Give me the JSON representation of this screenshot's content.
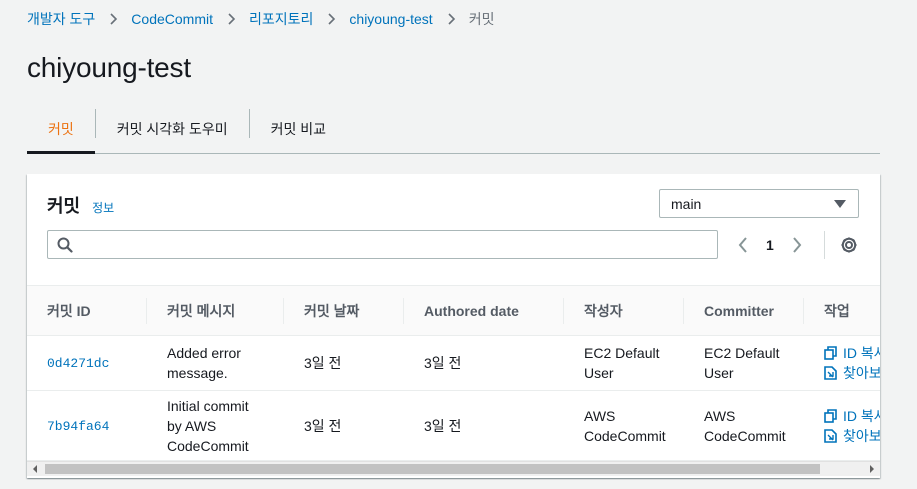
{
  "breadcrumb": {
    "items": [
      "개발자 도구",
      "CodeCommit",
      "리포지토리",
      "chiyoung-test"
    ],
    "current": "커밋"
  },
  "page_title": "chiyoung-test",
  "tabs": [
    {
      "label": "커밋",
      "active": true
    },
    {
      "label": "커밋 시각화 도우미",
      "active": false
    },
    {
      "label": "커밋 비교",
      "active": false
    }
  ],
  "panel": {
    "title": "커밋",
    "info_label": "정보",
    "branch": "main",
    "search_placeholder": "",
    "page": "1"
  },
  "table": {
    "columns": [
      "커밋 ID",
      "커밋 메시지",
      "커밋 날짜",
      "Authored date",
      "작성자",
      "Committer",
      "작업"
    ],
    "rows": [
      {
        "commit_id": "0d4271dc",
        "message": "Added error message.",
        "commit_date": "3일 전",
        "authored_date": "3일 전",
        "author": "EC2 Default User",
        "committer": "EC2 Default User",
        "action_copy": "ID 복사",
        "action_browse": "찾아보기"
      },
      {
        "commit_id": "7b94fa64",
        "message": "Initial commit by AWS CodeCommit",
        "commit_date": "3일 전",
        "authored_date": "3일 전",
        "author": "AWS CodeCommit",
        "committer": "AWS CodeCommit",
        "action_copy": "ID 복사",
        "action_browse": "찾아보기"
      }
    ]
  },
  "colors": {
    "link": "#0073bb",
    "active_tab": "#ec7211",
    "text": "#16191f"
  }
}
